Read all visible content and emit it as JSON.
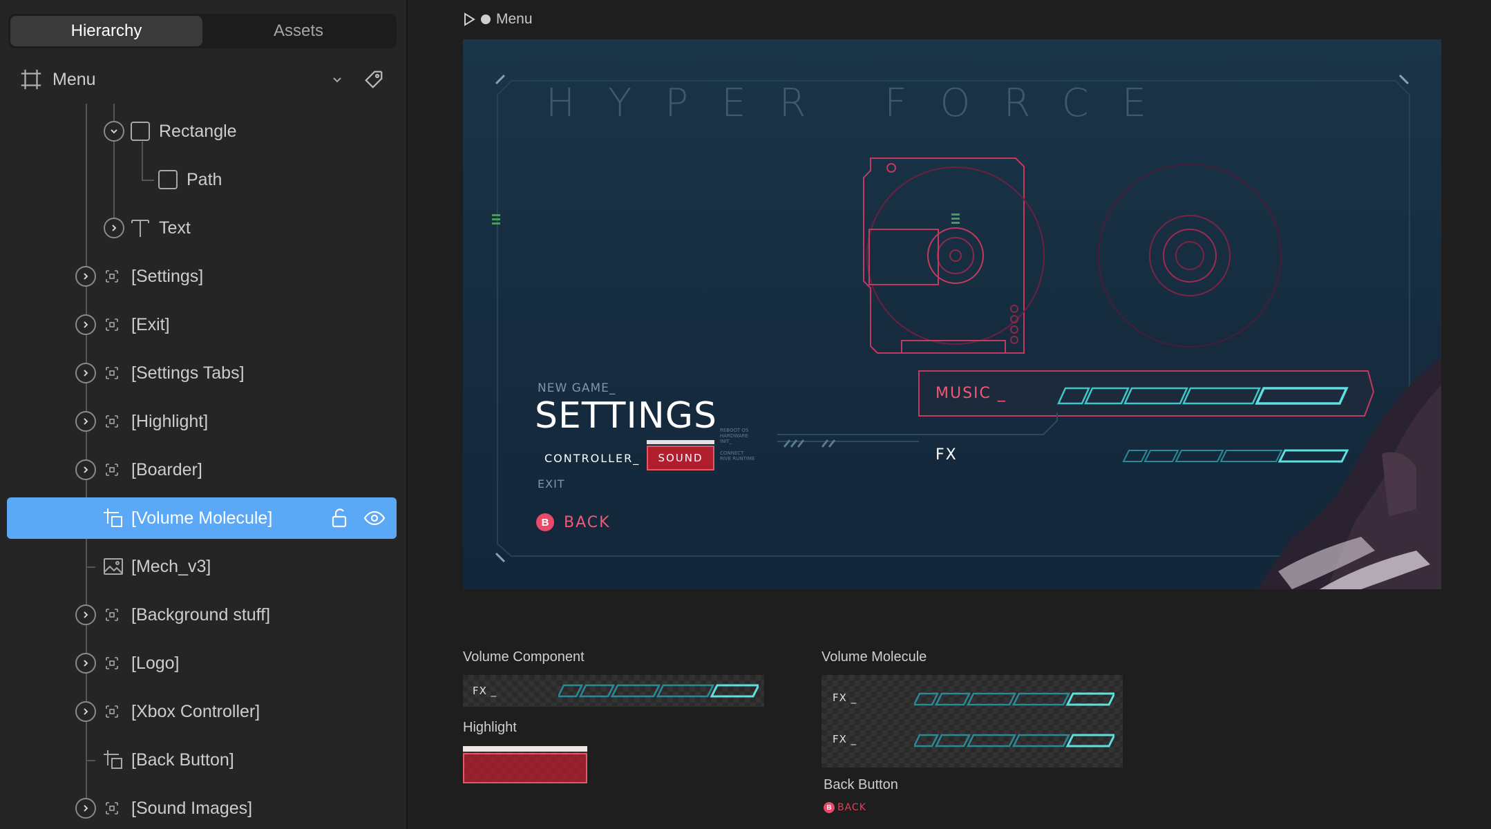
{
  "left_panel": {
    "tabs": [
      {
        "label": "Hierarchy",
        "active": true
      },
      {
        "label": "Assets",
        "active": false
      }
    ],
    "root": {
      "label": "Menu",
      "icon": "frame-icon"
    },
    "items": [
      {
        "label": "Rectangle",
        "icon": "rectangle-icon"
      },
      {
        "label": "Path",
        "icon": "path-icon"
      },
      {
        "label": "Text",
        "icon": "text-icon"
      },
      {
        "label": "[Settings]",
        "icon": "group-icon"
      },
      {
        "label": "[Exit]",
        "icon": "group-icon"
      },
      {
        "label": "[Settings Tabs]",
        "icon": "group-icon"
      },
      {
        "label": "[Highlight]",
        "icon": "group-icon"
      },
      {
        "label": "[Boarder]",
        "icon": "group-icon"
      },
      {
        "label": "[Volume Molecule]",
        "icon": "component-icon",
        "selected": true
      },
      {
        "label": "[Mech_v3]",
        "icon": "image-icon"
      },
      {
        "label": "[Background stuff]",
        "icon": "group-icon"
      },
      {
        "label": "[Logo]",
        "icon": "group-icon"
      },
      {
        "label": "[Xbox Controller]",
        "icon": "group-icon"
      },
      {
        "label": "[Back Button]",
        "icon": "component-icon"
      },
      {
        "label": "[Sound Images]",
        "icon": "group-icon"
      }
    ]
  },
  "canvas": {
    "artboard_title": "Menu",
    "preview": {
      "logo": "HYPER FORCE",
      "new_game": "NEW GAME_",
      "settings": "SETTINGS",
      "controller": "CONTROLLER_",
      "sound": "SOUND",
      "exit": "EXIT",
      "back_icon": "B",
      "back": "BACK",
      "music": "MUSIC _",
      "fx": "FX",
      "tiny_notes": [
        "REBOOT OS",
        "HARDWARE",
        "INIT_",
        "CONNECT",
        "RIVE RUNTIME"
      ]
    },
    "components": {
      "volume_component": {
        "title": "Volume Component",
        "fx": "FX _"
      },
      "highlight": {
        "title": "Highlight"
      },
      "volume_molecule": {
        "title": "Volume Molecule",
        "fx1": "FX _",
        "fx2": "FX _"
      },
      "back_button": {
        "title": "Back Button",
        "icon": "B",
        "label": "BACK"
      }
    }
  },
  "colors": {
    "selection": "#5aa8f6",
    "accent_pink": "#f05877",
    "accent_teal": "#3fc8c8",
    "sound_red": "#b01e2d"
  }
}
